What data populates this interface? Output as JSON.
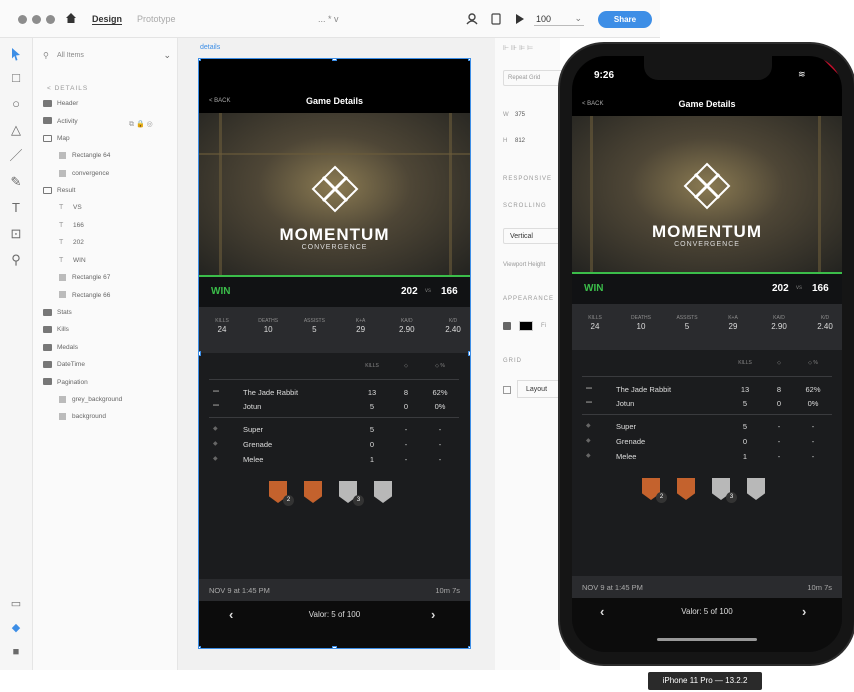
{
  "toolbar_top": {
    "home_icon": "home-icon",
    "mode_design": "Design",
    "mode_prototype": "Prototype",
    "doc_title": "... * v",
    "zoom_value": "100",
    "share_label": "Share"
  },
  "layers": {
    "search_placeholder": "All Items",
    "breadcrumb": "< DETAILS",
    "items": [
      {
        "label": "Header",
        "kind": "folder"
      },
      {
        "label": "Activity",
        "kind": "folder"
      },
      {
        "label": "Map",
        "kind": "folder-open"
      },
      {
        "label": "Rectangle 64",
        "kind": "rect"
      },
      {
        "label": "convergence",
        "kind": "rect"
      },
      {
        "label": "Result",
        "kind": "folder-open"
      },
      {
        "label": "VS",
        "kind": "text"
      },
      {
        "label": "166",
        "kind": "text"
      },
      {
        "label": "202",
        "kind": "text"
      },
      {
        "label": "WIN",
        "kind": "text"
      },
      {
        "label": "Rectangle 67",
        "kind": "rect"
      },
      {
        "label": "Rectangle 66",
        "kind": "rect"
      },
      {
        "label": "Stats",
        "kind": "folder"
      },
      {
        "label": "Kills",
        "kind": "folder"
      },
      {
        "label": "Medals",
        "kind": "folder"
      },
      {
        "label": "DateTime",
        "kind": "folder"
      },
      {
        "label": "Pagination",
        "kind": "folder"
      },
      {
        "label": "grey_background",
        "kind": "rect"
      },
      {
        "label": "background",
        "kind": "rect"
      }
    ]
  },
  "canvas": {
    "artboard_label": "details"
  },
  "app": {
    "back_label": "< BACK",
    "header_title": "Game Details",
    "map_name": "MOMENTUM",
    "map_sub": "CONVERGENCE",
    "result": "WIN",
    "score_a": "202",
    "vs": "vs",
    "score_b": "166",
    "stats": [
      {
        "label": "KILLS",
        "value": "24"
      },
      {
        "label": "DEATHS",
        "value": "10"
      },
      {
        "label": "ASSISTS",
        "value": "5"
      },
      {
        "label": "K+A",
        "value": "29"
      },
      {
        "label": "KA/D",
        "value": "2.90"
      },
      {
        "label": "K/D",
        "value": "2.40"
      }
    ],
    "weapon_headers": [
      "KILLS",
      "◇",
      "◇ %"
    ],
    "weapons": [
      {
        "name": "The Jade Rabbit",
        "kills": "13",
        "prec": "8",
        "pct": "62%"
      },
      {
        "name": "Jotun",
        "kills": "5",
        "prec": "0",
        "pct": "0%"
      }
    ],
    "abilities": [
      {
        "name": "Super",
        "kills": "5",
        "prec": "-",
        "pct": "-"
      },
      {
        "name": "Grenade",
        "kills": "0",
        "prec": "-",
        "pct": "-"
      },
      {
        "name": "Melee",
        "kills": "1",
        "prec": "-",
        "pct": "-"
      }
    ],
    "medal_counts": [
      "2",
      "",
      "3",
      ""
    ],
    "date": "NOV 9 at 1:45 PM",
    "duration": "10m 7s",
    "page_label": "Valor: 5 of 100"
  },
  "props": {
    "repeat_grid": "Repeat Grid",
    "w_label": "W",
    "w_value": "375",
    "h_label": "H",
    "h_value": "812",
    "responsive": "RESPONSIVE",
    "scrolling": "SCROLLING",
    "scroll_value": "Vertical",
    "viewport": "Viewport Height",
    "appearance": "APPEARANCE",
    "fill_letter": "Fi",
    "grid": "GRID",
    "layout": "Layout"
  },
  "phone": {
    "time": "9:26",
    "model": "iPhone 11 Pro — 13.2.2"
  },
  "colors": {
    "accent": "#3bbd4a",
    "share": "#3d8ee6",
    "panel": "#1b1c1e"
  }
}
